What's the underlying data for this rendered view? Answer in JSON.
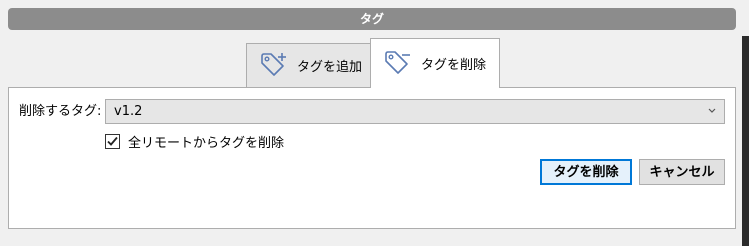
{
  "window": {
    "title": "タグ"
  },
  "tabs": [
    {
      "label": "タグを追加",
      "icon": "tag-add-icon",
      "selected": false
    },
    {
      "label": "タグを削除",
      "icon": "tag-remove-icon",
      "selected": true
    }
  ],
  "form": {
    "tag_label": "削除するタグ:",
    "tag_value": "v1.2",
    "all_remotes_label": "全リモートからタグを削除",
    "all_remotes_checked": true
  },
  "buttons": {
    "delete_label": "タグを削除",
    "cancel_label": "キャンセル"
  },
  "colors": {
    "title_bar": "#8c8c8c",
    "accent": "#0078d7"
  }
}
